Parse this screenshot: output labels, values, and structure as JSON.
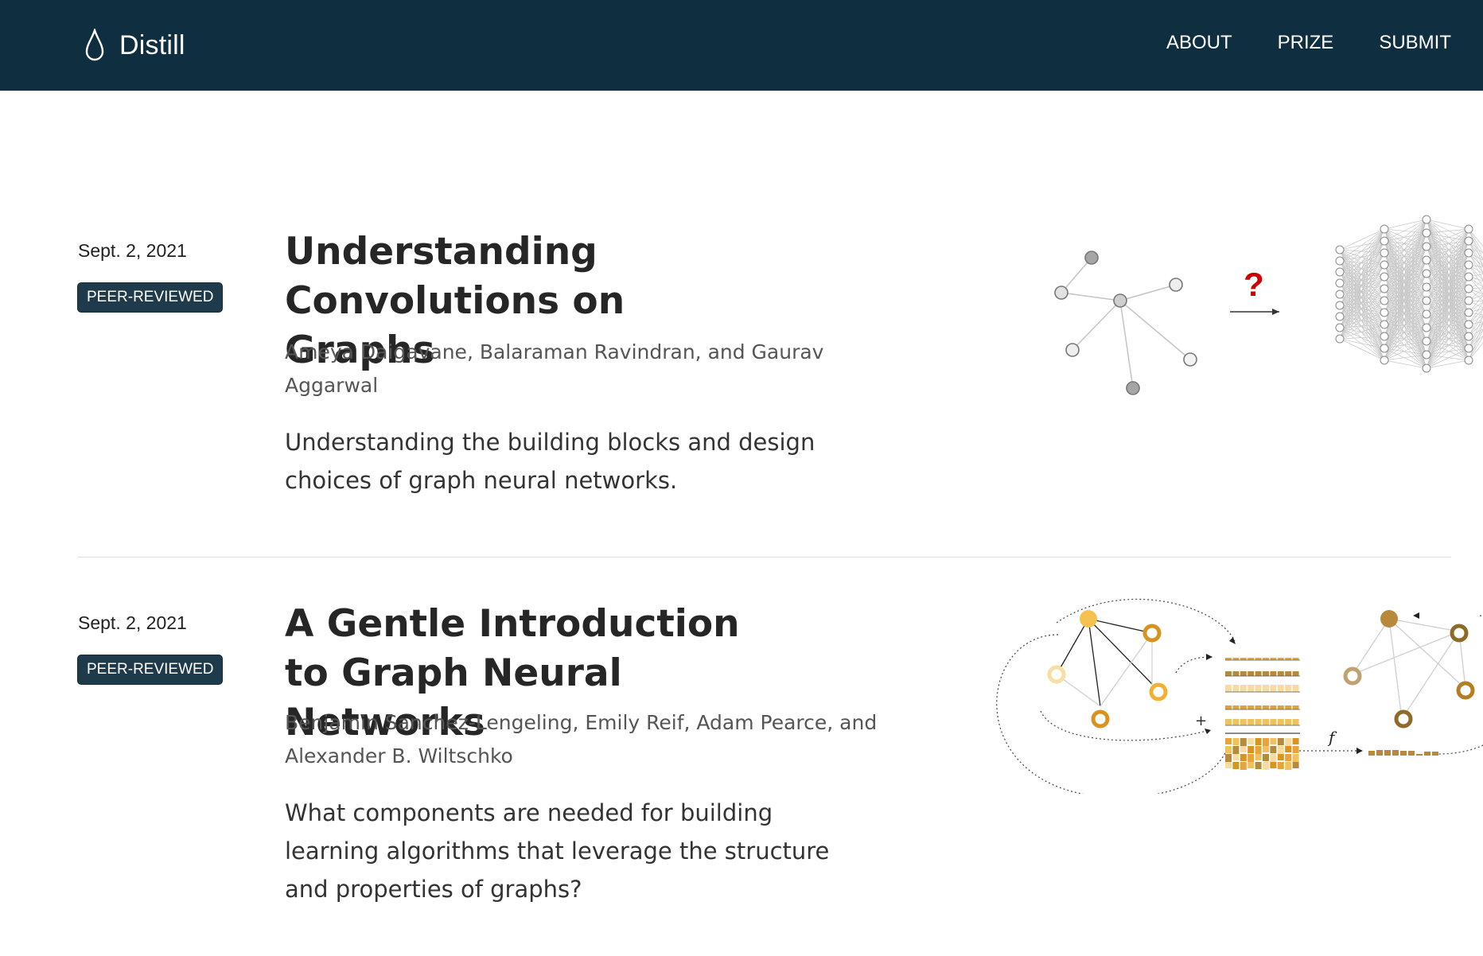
{
  "header": {
    "logo_text": "Distill",
    "logo_icon": "drop-icon",
    "nav": [
      {
        "label": "ABOUT"
      },
      {
        "label": "PRIZE"
      },
      {
        "label": "SUBMIT"
      }
    ]
  },
  "posts": [
    {
      "date": "Sept. 2, 2021",
      "badge": "PEER-REVIEWED",
      "title": "Understanding Convolutions on Graphs",
      "authors": "Ameya Daigavane, Balaraman Ravindran, and Gaurav Aggarwal",
      "description": "Understanding the building blocks and design choices of graph neural networks.",
      "thumbnail": {
        "question_mark": "?"
      }
    },
    {
      "date": "Sept. 2, 2021",
      "badge": "PEER-REVIEWED",
      "title": "A Gentle Introduction to Graph Neural Networks",
      "authors": "Benjamin Sanchez-Lengeling, Emily Reif, Adam Pearce, and Alexander B. Wiltschko",
      "description": "What components are needed for building learning algorithms that leverage the structure and properties of graphs?",
      "thumbnail": {
        "plus": "+",
        "function_symbol": "f"
      }
    }
  ],
  "colors": {
    "header_bg": "#0f2e3f",
    "badge_bg": "#1f3b4b",
    "accent_gold": "#e8a33a",
    "question_red": "#cc0000"
  }
}
